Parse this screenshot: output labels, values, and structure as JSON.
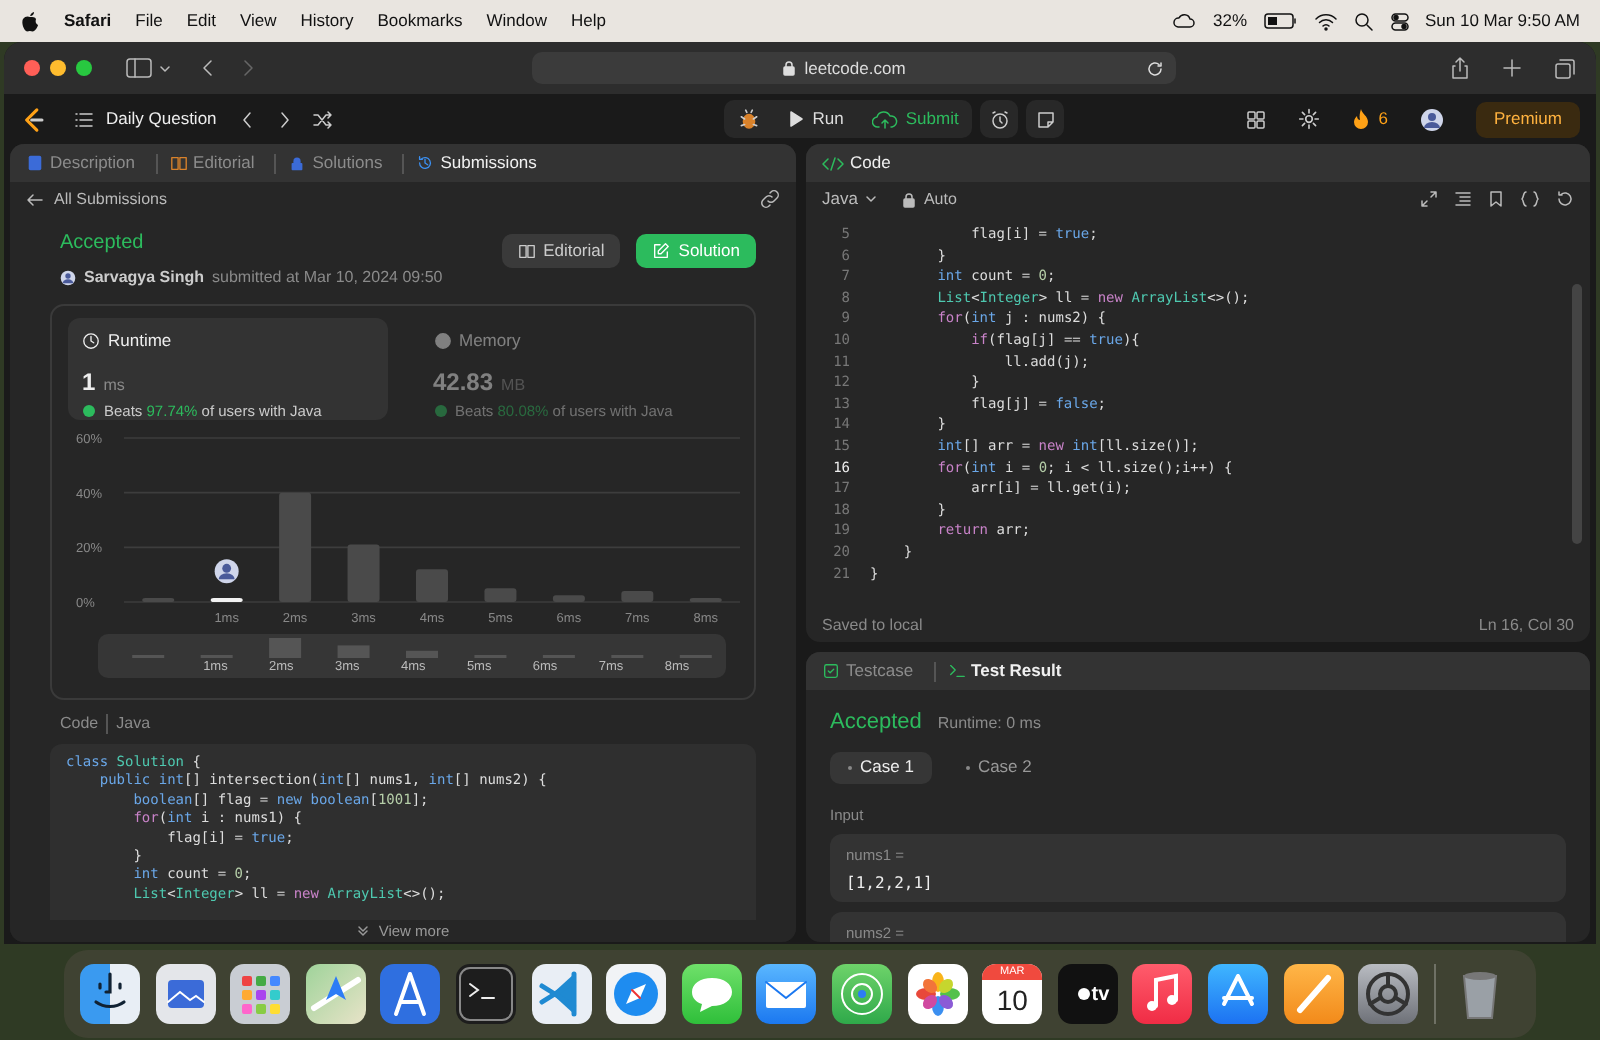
{
  "menu_bar": {
    "items": [
      {
        "label": "Safari",
        "bold": true
      },
      {
        "label": "File",
        "bold": false
      },
      {
        "label": "Edit",
        "bold": false
      },
      {
        "label": "View",
        "bold": false
      },
      {
        "label": "History",
        "bold": false
      },
      {
        "label": "Bookmarks",
        "bold": false
      },
      {
        "label": "Window",
        "bold": false
      },
      {
        "label": "Help",
        "bold": false
      }
    ],
    "battery": "32%",
    "datetime": "Sun 10 Mar  9:50 AM"
  },
  "browser": {
    "address": "leetcode.com"
  },
  "top_nav": {
    "title": "Daily Question",
    "run": "Run",
    "submit": "Submit",
    "streak": "6",
    "premium": "Premium"
  },
  "left_panel": {
    "tabs": [
      {
        "label": "Description",
        "selected": false
      },
      {
        "label": "Editorial",
        "selected": false
      },
      {
        "label": "Solutions",
        "selected": false
      },
      {
        "label": "Submissions",
        "selected": true
      }
    ],
    "back_link": "All Submissions",
    "status": "Accepted",
    "author": "Sarvagya Singh",
    "submitted": "submitted at Mar 10, 2024 09:50",
    "buttons": [
      {
        "label": "Editorial",
        "kind": "secondary"
      },
      {
        "label": "Solution",
        "kind": "primary"
      }
    ],
    "metrics": [
      {
        "label": "Runtime",
        "value": "1",
        "unit": "ms",
        "beats": "Beats",
        "percent": "97.74%",
        "suffix": "of users with Java",
        "selected": true
      },
      {
        "label": "Memory",
        "value": "42.83",
        "unit": "MB",
        "beats": "Beats",
        "percent": "80.08%",
        "suffix": "of users with Java",
        "selected": false
      }
    ],
    "chart_data": {
      "type": "bar",
      "categories": [
        null,
        "1ms",
        "2ms",
        "3ms",
        "4ms",
        "5ms",
        "6ms",
        "7ms",
        "8ms"
      ],
      "values": [
        1,
        1,
        40,
        21,
        12,
        5,
        2.5,
        4,
        1.5
      ],
      "ylim": [
        0,
        60
      ],
      "yticks": [
        {
          "value": 0,
          "label": "0%"
        },
        {
          "value": 20,
          "label": "20%"
        },
        {
          "value": 40,
          "label": "40%"
        },
        {
          "value": 60,
          "label": "60%"
        }
      ],
      "annotations": [
        {
          "x": "1ms"
        }
      ]
    },
    "range_labels": [
      "1ms",
      "2ms",
      "3ms",
      "4ms",
      "5ms",
      "6ms",
      "7ms",
      "8ms"
    ],
    "code_label": "Code",
    "code_language": "Java",
    "code_lines": [
      [
        {
          "kind": "keyword",
          "text": "class"
        },
        {
          "kind": "type",
          "text": " Solution"
        },
        {
          "kind": "plain",
          "text": " {"
        }
      ],
      [
        {
          "kind": "keyword",
          "text": "    public"
        },
        {
          "kind": "keyword",
          "text": " int"
        },
        {
          "kind": "plain",
          "text": "[] intersection("
        },
        {
          "kind": "keyword",
          "text": "int"
        },
        {
          "kind": "plain",
          "text": "[] nums1, "
        },
        {
          "kind": "keyword",
          "text": "int"
        },
        {
          "kind": "plain",
          "text": "[] nums2) {"
        }
      ],
      [
        {
          "kind": "keyword",
          "text": "        boolean"
        },
        {
          "kind": "plain",
          "text": "[] flag = "
        },
        {
          "kind": "keyword",
          "text": "new"
        },
        {
          "kind": "keyword",
          "text": " boolean"
        },
        {
          "kind": "plain",
          "text": "["
        },
        {
          "kind": "number",
          "text": "1001"
        },
        {
          "kind": "plain",
          "text": "];"
        }
      ],
      [
        {
          "kind": "control",
          "text": "        for"
        },
        {
          "kind": "plain",
          "text": "("
        },
        {
          "kind": "keyword",
          "text": "int"
        },
        {
          "kind": "plain",
          "text": " i : nums1) {"
        }
      ],
      [
        {
          "kind": "plain",
          "text": "            flag[i] = "
        },
        {
          "kind": "keyword",
          "text": "true"
        },
        {
          "kind": "plain",
          "text": ";"
        }
      ],
      [
        {
          "kind": "plain",
          "text": "        }"
        }
      ],
      [
        {
          "kind": "keyword",
          "text": "        int"
        },
        {
          "kind": "plain",
          "text": " count = "
        },
        {
          "kind": "number",
          "text": "0"
        },
        {
          "kind": "plain",
          "text": ";"
        }
      ],
      [
        {
          "kind": "type",
          "text": "        List"
        },
        {
          "kind": "plain",
          "text": "<"
        },
        {
          "kind": "type",
          "text": "Integer"
        },
        {
          "kind": "plain",
          "text": "> ll = "
        },
        {
          "kind": "control",
          "text": "new"
        },
        {
          "kind": "type",
          "text": " ArrayList"
        },
        {
          "kind": "plain",
          "text": "<>();"
        }
      ]
    ],
    "view_more": "View more"
  },
  "editor": {
    "tab": "Code",
    "language": "Java",
    "mode": "Auto",
    "lines": [
      {
        "number": "5",
        "current": false,
        "tokens": [
          {
            "kind": "plain",
            "text": "            flag[i] = "
          },
          {
            "kind": "keyword",
            "text": "true"
          },
          {
            "kind": "plain",
            "text": ";"
          }
        ]
      },
      {
        "number": "6",
        "current": false,
        "tokens": [
          {
            "kind": "plain",
            "text": "        }"
          }
        ]
      },
      {
        "number": "7",
        "current": false,
        "tokens": [
          {
            "kind": "keyword",
            "text": "        int"
          },
          {
            "kind": "plain",
            "text": " count = "
          },
          {
            "kind": "number",
            "text": "0"
          },
          {
            "kind": "plain",
            "text": ";"
          }
        ]
      },
      {
        "number": "8",
        "current": false,
        "tokens": [
          {
            "kind": "type",
            "text": "        List"
          },
          {
            "kind": "plain",
            "text": "<"
          },
          {
            "kind": "type",
            "text": "Integer"
          },
          {
            "kind": "plain",
            "text": "> ll = "
          },
          {
            "kind": "control",
            "text": "new"
          },
          {
            "kind": "type",
            "text": " ArrayList"
          },
          {
            "kind": "plain",
            "text": "<>();"
          }
        ]
      },
      {
        "number": "9",
        "current": false,
        "tokens": [
          {
            "kind": "control",
            "text": "        for"
          },
          {
            "kind": "plain",
            "text": "("
          },
          {
            "kind": "keyword",
            "text": "int"
          },
          {
            "kind": "plain",
            "text": " j : nums2) {"
          }
        ]
      },
      {
        "number": "10",
        "current": false,
        "tokens": [
          {
            "kind": "control",
            "text": "            if"
          },
          {
            "kind": "plain",
            "text": "(flag[j] == "
          },
          {
            "kind": "keyword",
            "text": "true"
          },
          {
            "kind": "plain",
            "text": "){"
          }
        ]
      },
      {
        "number": "11",
        "current": false,
        "tokens": [
          {
            "kind": "plain",
            "text": "                ll.add(j);"
          }
        ]
      },
      {
        "number": "12",
        "current": false,
        "tokens": [
          {
            "kind": "plain",
            "text": "            }"
          }
        ]
      },
      {
        "number": "13",
        "current": false,
        "tokens": [
          {
            "kind": "plain",
            "text": "            flag[j] = "
          },
          {
            "kind": "keyword",
            "text": "false"
          },
          {
            "kind": "plain",
            "text": ";"
          }
        ]
      },
      {
        "number": "14",
        "current": false,
        "tokens": [
          {
            "kind": "plain",
            "text": "        }"
          }
        ]
      },
      {
        "number": "15",
        "current": false,
        "tokens": [
          {
            "kind": "keyword",
            "text": "        int"
          },
          {
            "kind": "plain",
            "text": "[] arr = "
          },
          {
            "kind": "control",
            "text": "new"
          },
          {
            "kind": "keyword",
            "text": " int"
          },
          {
            "kind": "plain",
            "text": "[ll.size()];"
          }
        ]
      },
      {
        "number": "16",
        "current": true,
        "tokens": [
          {
            "kind": "control",
            "text": "        for"
          },
          {
            "kind": "plain",
            "text": "("
          },
          {
            "kind": "keyword",
            "text": "int"
          },
          {
            "kind": "plain",
            "text": " i = "
          },
          {
            "kind": "number",
            "text": "0"
          },
          {
            "kind": "plain",
            "text": "; i < ll.size();i++) {"
          }
        ]
      },
      {
        "number": "17",
        "current": false,
        "tokens": [
          {
            "kind": "plain",
            "text": "            arr[i] = ll.get(i);"
          }
        ]
      },
      {
        "number": "18",
        "current": false,
        "tokens": [
          {
            "kind": "plain",
            "text": "        }"
          }
        ]
      },
      {
        "number": "19",
        "current": false,
        "tokens": [
          {
            "kind": "control",
            "text": "        return"
          },
          {
            "kind": "plain",
            "text": " arr;"
          }
        ]
      },
      {
        "number": "20",
        "current": false,
        "tokens": [
          {
            "kind": "plain",
            "text": "    }"
          }
        ]
      },
      {
        "number": "21",
        "current": false,
        "tokens": [
          {
            "kind": "plain",
            "text": "}"
          }
        ]
      }
    ],
    "status": "Saved to local",
    "cursor": "Ln 16, Col 30"
  },
  "result_panel": {
    "tabs": [
      {
        "label": "Testcase",
        "selected": false
      },
      {
        "label": "Test Result",
        "selected": true
      }
    ],
    "status": "Accepted",
    "runtime": "Runtime: 0 ms",
    "cases": [
      {
        "label": "Case 1",
        "selected": true
      },
      {
        "label": "Case 2",
        "selected": false
      }
    ],
    "input_label": "Input",
    "inputs": [
      {
        "name": "nums1 =",
        "value": "[1,2,2,1]"
      },
      {
        "name": "nums2 ="
      }
    ]
  },
  "dock": {
    "apps": [
      {
        "kind": "finder"
      },
      {
        "kind": "preview"
      },
      {
        "kind": "launchpad"
      },
      {
        "kind": "maps"
      },
      {
        "kind": "instruments"
      },
      {
        "kind": "terminal"
      },
      {
        "kind": "vscode"
      },
      {
        "kind": "safari"
      },
      {
        "kind": "messages"
      },
      {
        "kind": "mail"
      },
      {
        "kind": "findmy"
      },
      {
        "kind": "photos"
      },
      {
        "kind": "calendar",
        "month": "MAR",
        "day": "10"
      },
      {
        "kind": "tv",
        "text": "tv"
      },
      {
        "kind": "music"
      },
      {
        "kind": "appstore"
      },
      {
        "kind": "pages"
      },
      {
        "kind": "settings"
      },
      {
        "kind": "separator"
      },
      {
        "kind": "trash"
      }
    ]
  }
}
